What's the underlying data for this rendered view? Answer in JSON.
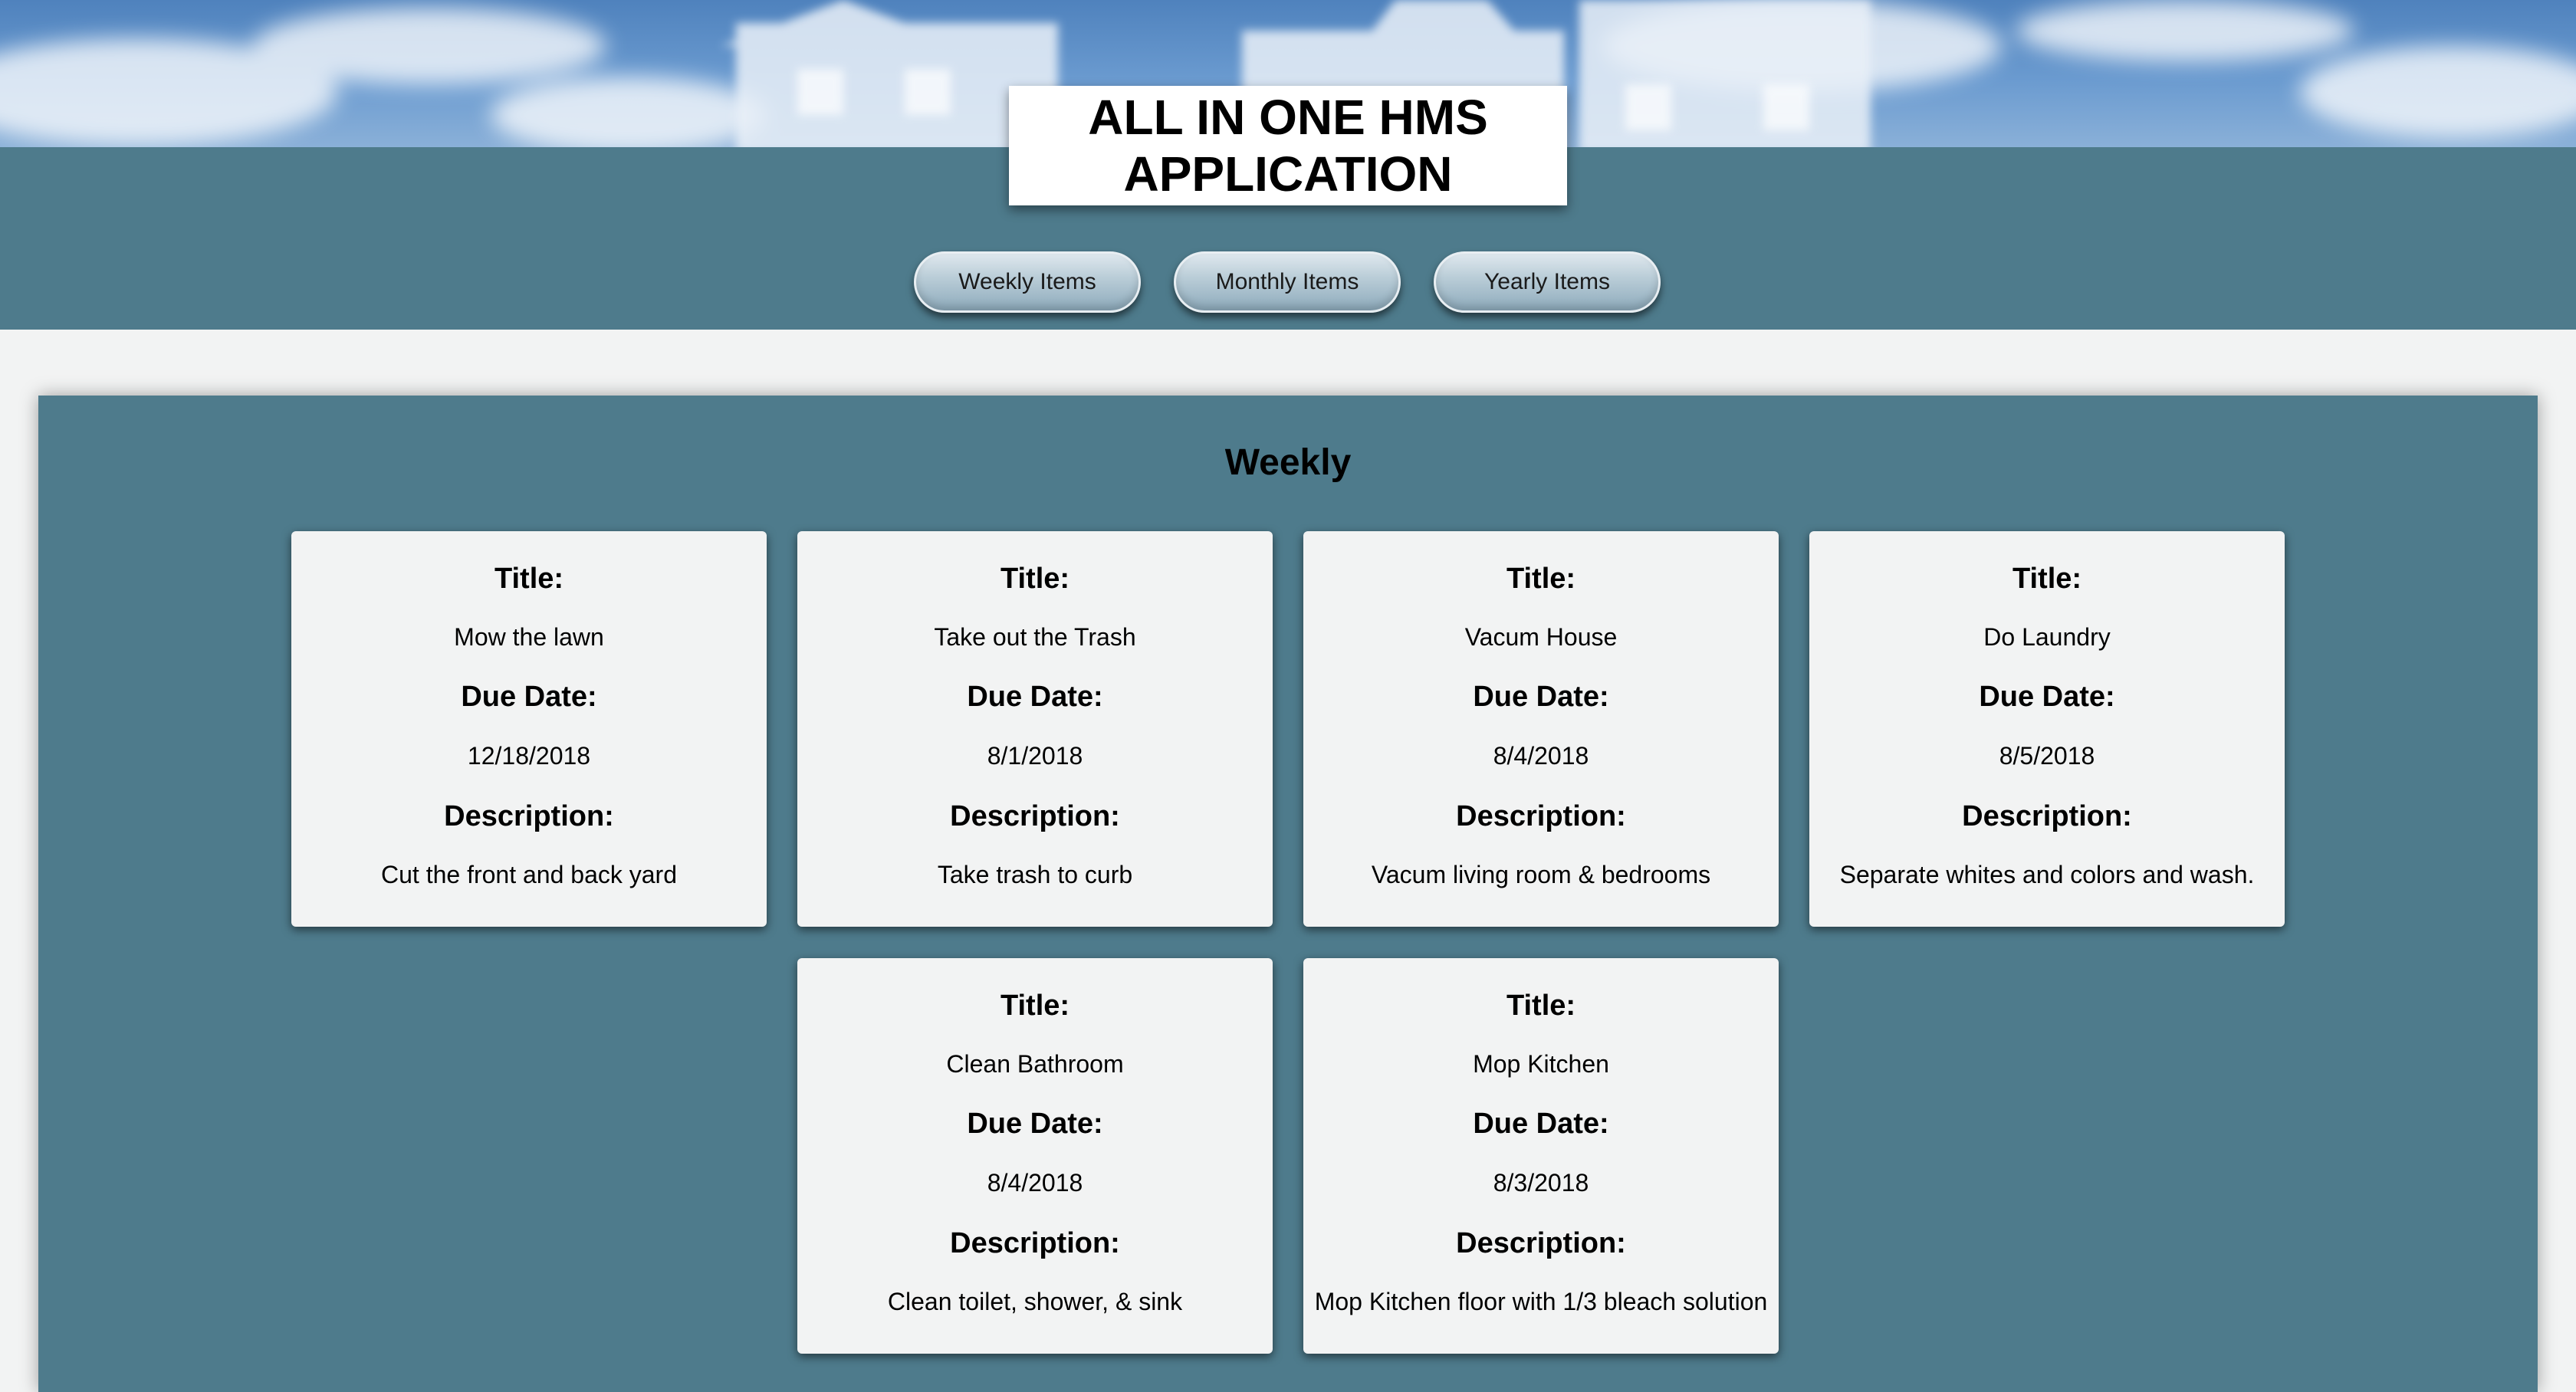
{
  "app": {
    "title": "ALL IN ONE HMS APPLICATION"
  },
  "nav": {
    "weekly_label": "Weekly Items",
    "monthly_label": "Monthly Items",
    "yearly_label": "Yearly Items"
  },
  "section": {
    "heading": "Weekly"
  },
  "cards": [
    {
      "title_label": "Title:",
      "title": "Mow the lawn",
      "due_label": "Due Date:",
      "due": "12/18/2018",
      "desc_label": "Description:",
      "desc": "Cut the front and back yard"
    },
    {
      "title_label": "Title:",
      "title": "Take out the Trash",
      "due_label": "Due Date:",
      "due": "8/1/2018",
      "desc_label": "Description:",
      "desc": "Take trash to curb"
    },
    {
      "title_label": "Title:",
      "title": "Vacum House",
      "due_label": "Due Date:",
      "due": "8/4/2018",
      "desc_label": "Description:",
      "desc": "Vacum living room & bedrooms"
    },
    {
      "title_label": "Title:",
      "title": "Do Laundry",
      "due_label": "Due Date:",
      "due": "8/5/2018",
      "desc_label": "Description:",
      "desc": "Separate whites and colors and wash."
    },
    {
      "title_label": "Title:",
      "title": "Clean Bathroom",
      "due_label": "Due Date:",
      "due": "8/4/2018",
      "desc_label": "Description:",
      "desc": "Clean toilet, shower, & sink"
    },
    {
      "title_label": "Title:",
      "title": "Mop Kitchen",
      "due_label": "Due Date:",
      "due": "8/3/2018",
      "desc_label": "Description:",
      "desc": "Mop Kitchen floor with 1/3 bleach solution"
    }
  ],
  "colors": {
    "header_bg": "#4e7b8c",
    "page_bg": "#f2f3f3",
    "card_bg": "#f2f3f3",
    "sky": "#5b8ec8"
  },
  "decor": {
    "header_image": "cloud-sky-house-banner"
  }
}
